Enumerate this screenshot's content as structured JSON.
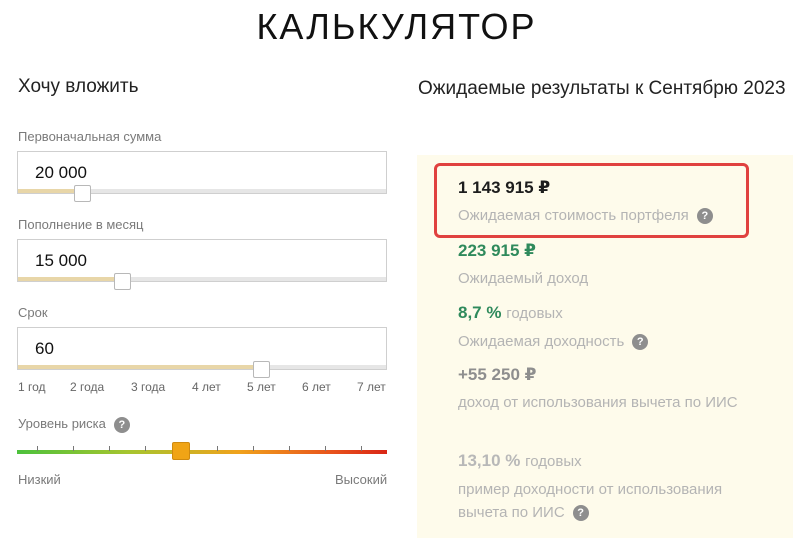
{
  "page_title": "КАЛЬКУЛЯТОР",
  "invest": {
    "heading": "Хочу вложить",
    "initial": {
      "label": "Первоначальная сумма",
      "value": "20 000"
    },
    "monthly": {
      "label": "Пополнение в месяц",
      "value": "15 000"
    },
    "term": {
      "label": "Срок",
      "value": "60",
      "ticks": [
        "1 год",
        "2 года",
        "3 года",
        "4 лет",
        "5 лет",
        "6 лет",
        "7 лет"
      ]
    },
    "risk": {
      "label": "Уровень риска",
      "low": "Низкий",
      "high": "Высокий",
      "help_icon": "?"
    }
  },
  "results": {
    "heading": "Ожидаемые результаты к Сентябрю 2023",
    "portfolio": {
      "amount": "1 143 915 ₽",
      "desc": "Ожидаемая стоимость портфеля",
      "help_icon": "?"
    },
    "income": {
      "amount": "223 915 ₽",
      "desc": "Ожидаемый доход"
    },
    "yield": {
      "amount": "8,7 %",
      "suffix": "годовых",
      "desc": "Ожидаемая доходность",
      "help_icon": "?"
    },
    "iis_income": {
      "amount": "+55 250 ₽",
      "desc": "доход от использования вычета по ИИС"
    },
    "iis_yield": {
      "amount": "13,10 %",
      "suffix": "годовых",
      "desc": "пример доходности от использования вычета по ИИС",
      "help_icon": "?"
    }
  },
  "colors": {
    "accent_green": "#2f8a5c",
    "highlight_red": "#e0413f",
    "risk_thumb": "#f0a416",
    "panel_bg": "#fefbeb"
  }
}
